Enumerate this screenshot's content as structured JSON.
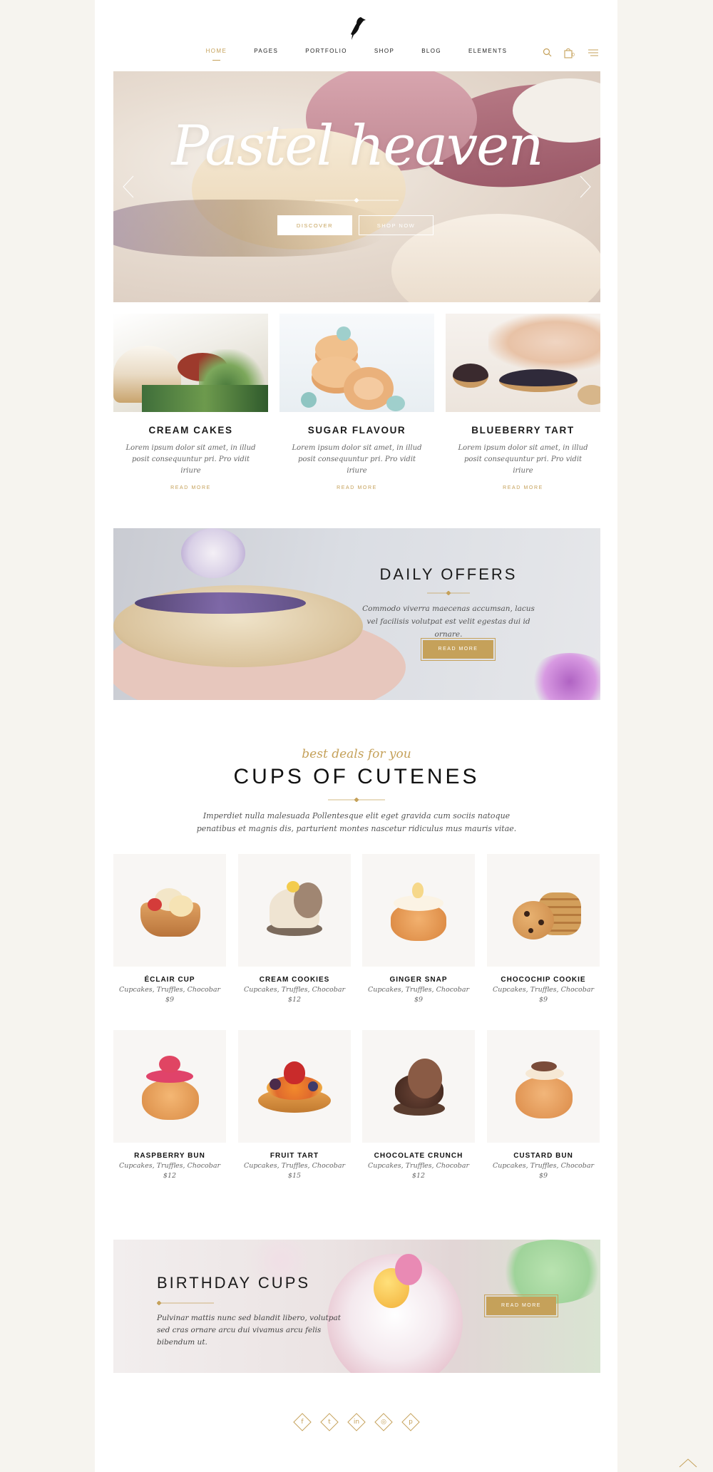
{
  "colors": {
    "accent": "#c5a15a",
    "dark": "#1a1a1a",
    "muted": "#666666"
  },
  "header": {
    "logo_icon": "bird-logo-icon",
    "nav": [
      "HOME",
      "PAGES",
      "PORTFOLIO",
      "SHOP",
      "BLOG",
      "ELEMENTS"
    ],
    "icons": [
      "search-icon",
      "cart-icon",
      "menu-icon"
    ],
    "cart_count": "0"
  },
  "hero": {
    "title": "Pastel heaven",
    "btn_discover": "DISCOVER",
    "btn_shop": "SHOP NOW"
  },
  "features": [
    {
      "title": "CREAM CAKES",
      "text": "Lorem ipsum dolor sit amet, in illud posit consequuntur pri. Pro vidit iriure",
      "link": "READ MORE"
    },
    {
      "title": "SUGAR FLAVOUR",
      "text": "Lorem ipsum dolor sit amet, in illud posit consequuntur pri. Pro vidit iriure",
      "link": "READ MORE"
    },
    {
      "title": "BLUEBERRY TART",
      "text": "Lorem ipsum dolor sit amet, in illud posit consequuntur pri. Pro vidit iriure",
      "link": "READ MORE"
    }
  ],
  "offers": {
    "title": "DAILY OFFERS",
    "text": "Commodo viverra maecenas accumsan, lacus vel facilisis volutpat est velit egestas dui id ornare.",
    "button": "READ MORE"
  },
  "cupcakes": {
    "tagline": "best deals for you",
    "title": "CUPS OF CUTENES",
    "text": "Imperdiet nulla malesuada Pollentesque elit eget gravida cum sociis natoque penatibus et magnis dis, parturient montes nascetur ridiculus mus mauris vitae.",
    "products": [
      {
        "name": "ÉCLAIR CUP",
        "category": "Cupcakes, Truffles, Chocobar",
        "price": "$9"
      },
      {
        "name": "CREAM COOKIES",
        "category": "Cupcakes, Truffles, Chocobar",
        "price": "$12"
      },
      {
        "name": "GINGER SNAP",
        "category": "Cupcakes, Truffles, Chocobar",
        "price": "$9"
      },
      {
        "name": "CHOCOCHIP COOKIE",
        "category": "Cupcakes, Truffles, Chocobar",
        "price": "$9"
      },
      {
        "name": "RASPBERRY BUN",
        "category": "Cupcakes, Truffles, Chocobar",
        "price": "$12"
      },
      {
        "name": "FRUIT TART",
        "category": "Cupcakes, Truffles, Chocobar",
        "price": "$15"
      },
      {
        "name": "CHOCOLATE CRUNCH",
        "category": "Cupcakes, Truffles, Chocobar",
        "price": "$12"
      },
      {
        "name": "CUSTARD BUN",
        "category": "Cupcakes, Truffles, Chocobar",
        "price": "$9"
      }
    ]
  },
  "birthday": {
    "title": "BIRTHDAY CUPS",
    "text": "Pulvinar mattis nunc sed blandit libero, volutpat sed cras ornare arcu dui vivamus arcu felis bibendum ut.",
    "button": "READ MORE"
  },
  "social": [
    {
      "icon": "facebook-icon",
      "glyph": "f"
    },
    {
      "icon": "twitter-icon",
      "glyph": "t"
    },
    {
      "icon": "linkedin-icon",
      "glyph": "in"
    },
    {
      "icon": "instagram-icon",
      "glyph": "◎"
    },
    {
      "icon": "pinterest-icon",
      "glyph": "p"
    }
  ]
}
